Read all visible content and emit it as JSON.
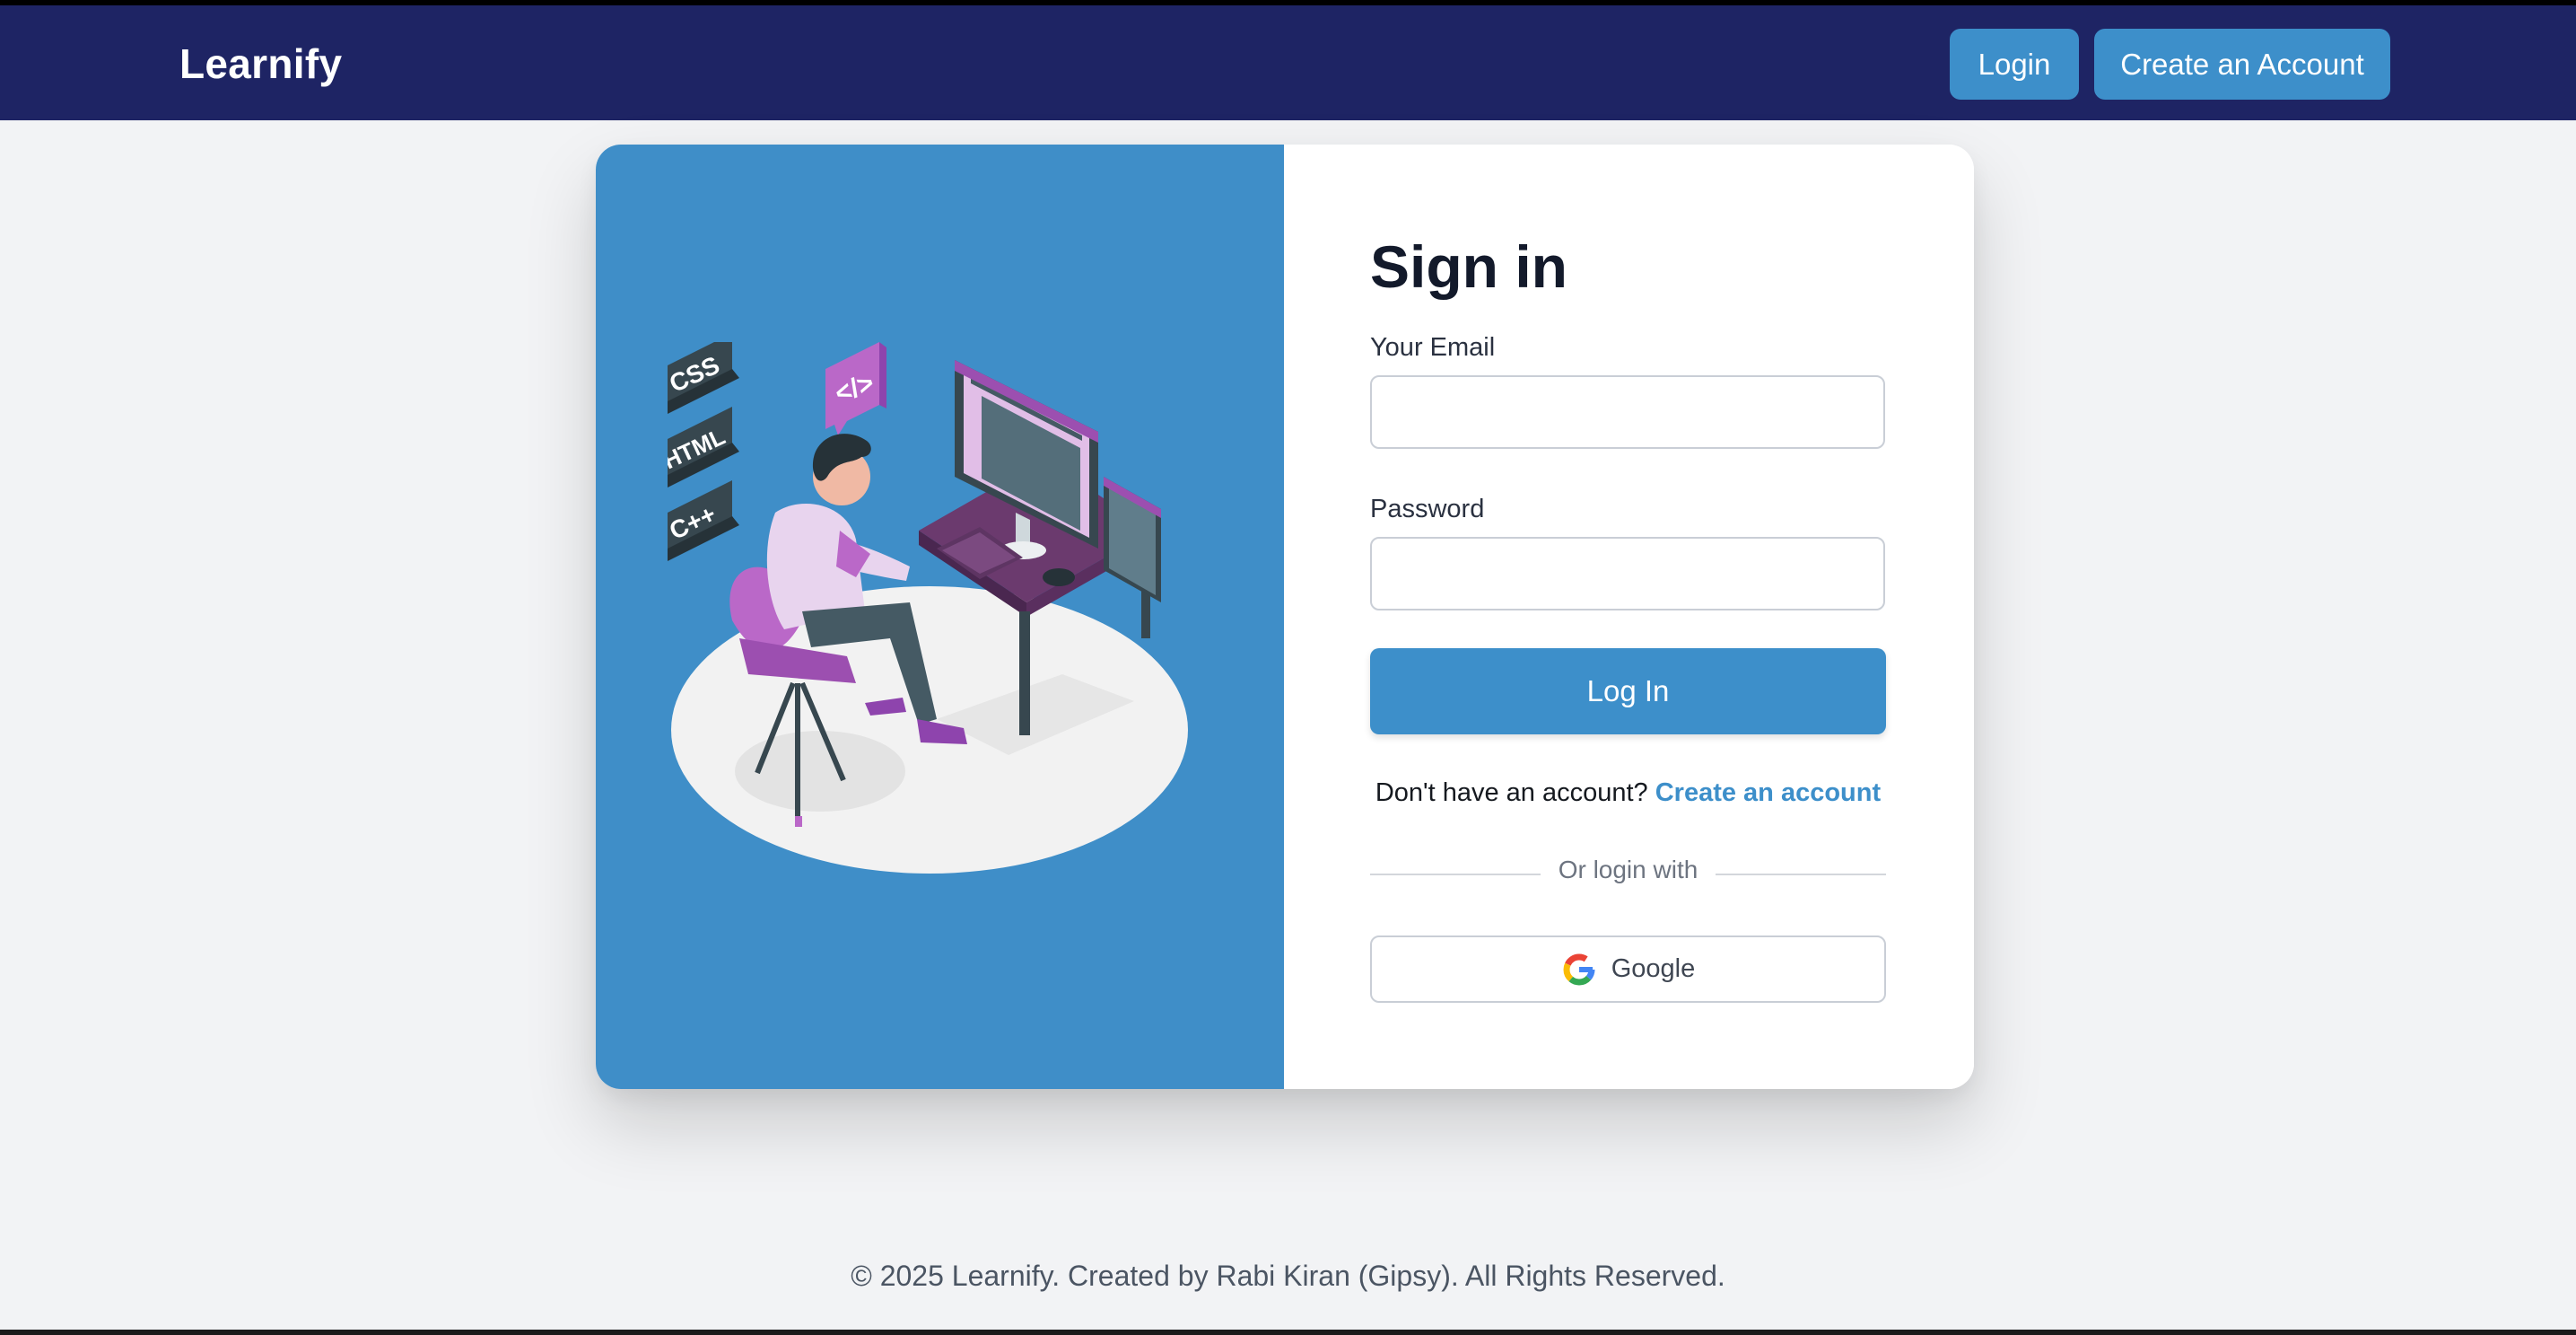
{
  "header": {
    "brand": "Learnify",
    "login_label": "Login",
    "create_account_label": "Create an Account"
  },
  "illustration": {
    "badges": [
      "CSS",
      "HTML",
      "C++"
    ],
    "code_tag": "</>"
  },
  "signin": {
    "title": "Sign in",
    "email_label": "Your Email",
    "email_value": "",
    "password_label": "Password",
    "password_value": "",
    "submit_label": "Log In",
    "no_account_text": "Don't have an account?",
    "create_link_label": "Create an account",
    "divider_text": "Or login with",
    "google_label": "Google"
  },
  "footer": {
    "text": "© 2025 Learnify. Created by Rabi Kiran (Gipsy). All Rights Reserved."
  },
  "colors": {
    "navbar": "#1e2464",
    "accent": "#3d8fca",
    "illustration_bg": "#3f8ec8",
    "page_bg": "#f2f3f5"
  }
}
